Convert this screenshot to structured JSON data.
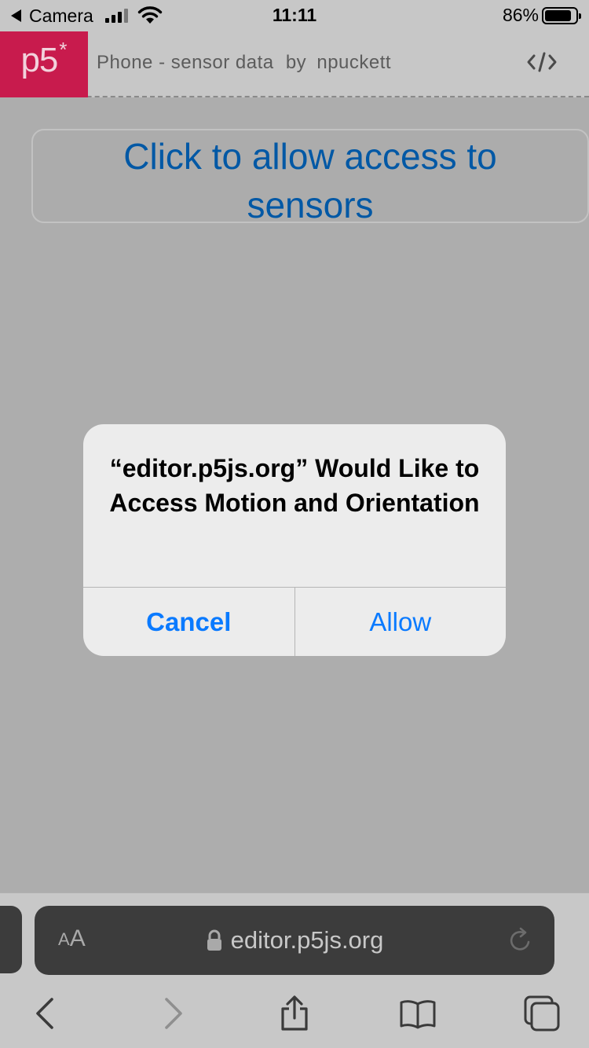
{
  "status_bar": {
    "back_app": "Camera",
    "time": "11:11",
    "battery_percent": "86%",
    "battery_level": 0.86,
    "signal_bars": 3,
    "signal_total": 4
  },
  "p5_header": {
    "logo_text": "p5",
    "logo_star": "*",
    "sketch_title": "Phone - sensor data",
    "by_text": "by",
    "author": "npuckett",
    "code_icon": "code-brackets-icon"
  },
  "page": {
    "sensor_button_line1": "Click to allow access to",
    "sensor_button_line2": "sensors"
  },
  "dialog": {
    "title": "“editor.p5js.org” Would Like to Access Motion and Orientation",
    "cancel_label": "Cancel",
    "allow_label": "Allow"
  },
  "address_bar": {
    "aa_small": "A",
    "aa_big": "A",
    "url": "editor.p5js.org"
  },
  "toolbar": {
    "icons": [
      "back-icon",
      "forward-icon",
      "share-icon",
      "bookmarks-icon",
      "tabs-icon"
    ]
  },
  "colors": {
    "p5_brand": "#c81b4d",
    "link_blue": "#0058a5",
    "ios_blue": "#0a7aff"
  }
}
